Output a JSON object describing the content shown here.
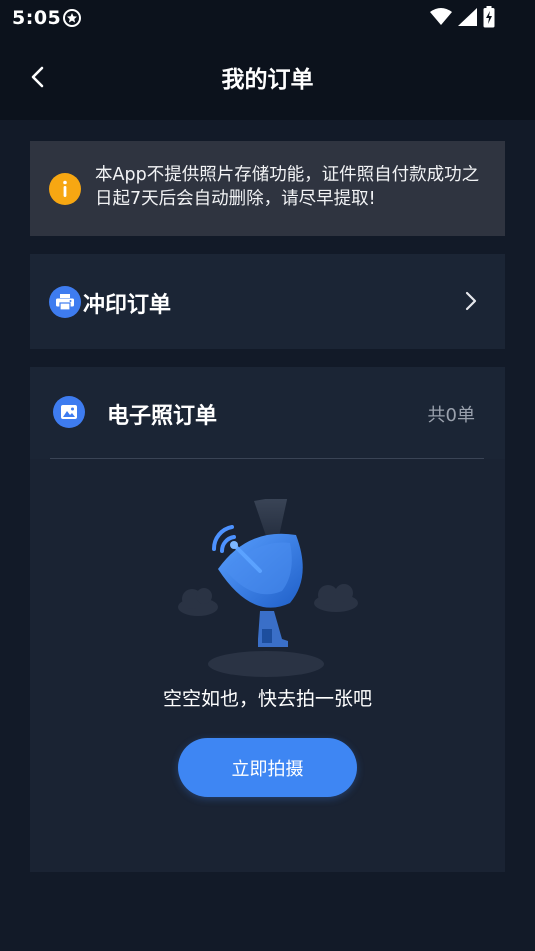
{
  "status_bar": {
    "time": "5:05",
    "left_icon": "shield-badge-icon",
    "right_icons": [
      "wifi-icon",
      "signal-icon",
      "battery-charging-icon"
    ]
  },
  "header": {
    "title": "我的订单",
    "back_icon": "chevron-left-icon"
  },
  "notice": {
    "icon": "info-icon",
    "text": "本App不提供照片存储功能，证件照自付款成功之日起7天后会自动删除，请尽早提取!",
    "accent": "#f7a712"
  },
  "print_orders": {
    "label": "冲印订单",
    "icon": "printer-icon",
    "chevron": "chevron-right-icon"
  },
  "photo_orders": {
    "label": "电子照订单",
    "icon": "image-icon",
    "count_text": "共0单",
    "empty_illustration": "satellite-dish-icon",
    "empty_text": "空空如也，快去拍一张吧",
    "button_label": "立即拍摄"
  },
  "colors": {
    "background": "#121a28",
    "card": "#1b2535",
    "notice_bg": "#2f3440",
    "brand": "#3e86f3"
  }
}
